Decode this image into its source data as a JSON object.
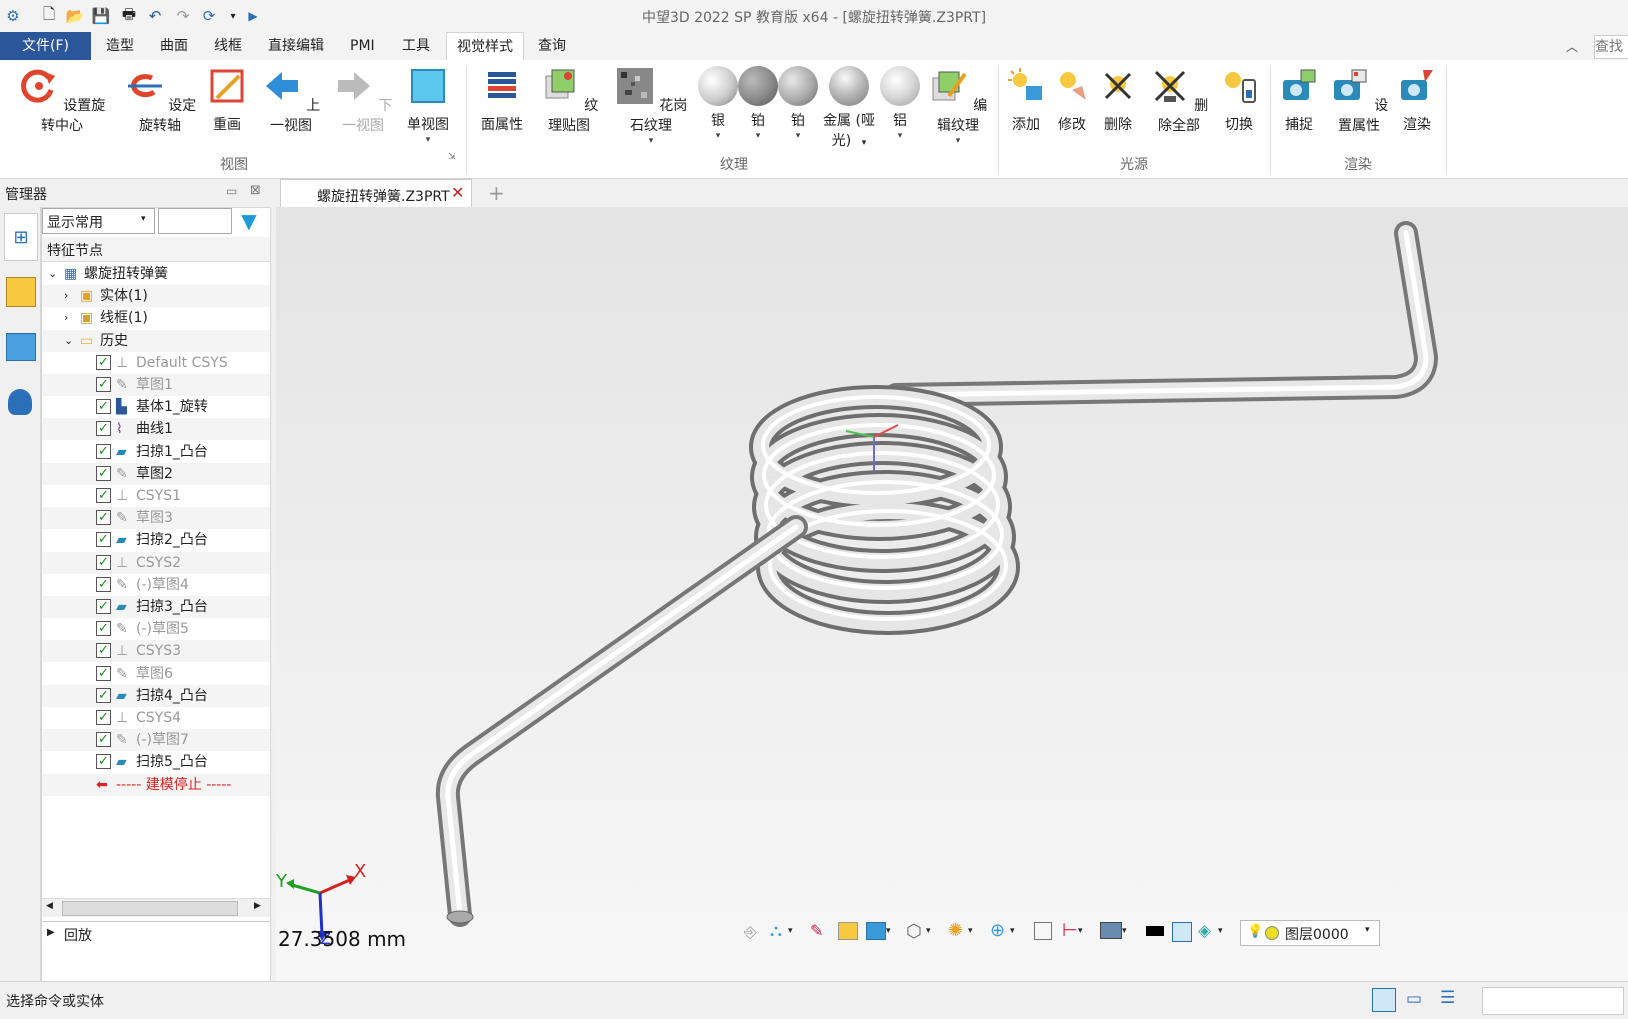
{
  "window": {
    "title": "中望3D 2022 SP 教育版 x64 - [螺旋扭转弹簧.Z3PRT]",
    "search_placeholder": "查找"
  },
  "menu": {
    "file": "文件(F)",
    "tabs": [
      "造型",
      "曲面",
      "线框",
      "直接编辑",
      "PMI",
      "工具",
      "视觉样式",
      "查询"
    ],
    "active_tab": "视觉样式"
  },
  "ribbon": {
    "view_group": {
      "label": "视图",
      "buttons": [
        "设置旋转中心",
        "设定旋转轴",
        "重画",
        "上一视图",
        "下一视图",
        "单视图"
      ]
    },
    "texture_group": {
      "label": "纹理",
      "buttons": [
        "面属性",
        "纹理贴图",
        "花岗石纹理",
        "银",
        "铂",
        "铂",
        "金属 (哑光)",
        "铝",
        "编辑纹理"
      ],
      "metal_line1": "金属 (哑",
      "metal_line2": "光)"
    },
    "light_group": {
      "label": "光源",
      "buttons": [
        "添加",
        "修改",
        "删除",
        "删除全部",
        "切换"
      ]
    },
    "render_group": {
      "label": "渲染",
      "buttons": [
        "捕捉",
        "设置属性",
        "渲染"
      ]
    }
  },
  "manager": {
    "title": "管理器",
    "filter_value": "显示常用",
    "column_header": "特征节点",
    "playback_label": "回放",
    "tree": [
      {
        "label": "螺旋扭转弹簧",
        "level": 0,
        "expander": "open",
        "icon": "part-icon"
      },
      {
        "label": "实体(1)",
        "level": 1,
        "expander": "closed",
        "icon": "solid-folder-icon"
      },
      {
        "label": "线框(1)",
        "level": 1,
        "expander": "closed",
        "icon": "wireframe-folder-icon"
      },
      {
        "label": "历史",
        "level": 1,
        "expander": "open",
        "icon": "history-folder-icon"
      },
      {
        "label": "Default CSYS",
        "level": 2,
        "checked": true,
        "grey": true,
        "icon": "csys-icon"
      },
      {
        "label": "草图1",
        "level": 2,
        "checked": true,
        "grey": true,
        "icon": "sketch-icon"
      },
      {
        "label": "基体1_旋转",
        "level": 2,
        "checked": true,
        "grey": false,
        "icon": "revolve-icon"
      },
      {
        "label": "曲线1",
        "level": 2,
        "checked": true,
        "grey": false,
        "icon": "curve-icon"
      },
      {
        "label": "扫掠1_凸台",
        "level": 2,
        "checked": true,
        "grey": false,
        "icon": "sweep-icon"
      },
      {
        "label": "草图2",
        "level": 2,
        "checked": true,
        "grey": false,
        "icon": "sketch-icon"
      },
      {
        "label": "CSYS1",
        "level": 2,
        "checked": true,
        "grey": true,
        "icon": "csys-icon"
      },
      {
        "label": "草图3",
        "level": 2,
        "checked": true,
        "grey": true,
        "icon": "sketch-icon"
      },
      {
        "label": "扫掠2_凸台",
        "level": 2,
        "checked": true,
        "grey": false,
        "icon": "sweep-icon"
      },
      {
        "label": "CSYS2",
        "level": 2,
        "checked": true,
        "grey": true,
        "icon": "csys-icon"
      },
      {
        "label": "(-)草图4",
        "level": 2,
        "checked": true,
        "grey": true,
        "icon": "sketch-icon"
      },
      {
        "label": "扫掠3_凸台",
        "level": 2,
        "checked": true,
        "grey": false,
        "icon": "sweep-icon"
      },
      {
        "label": "(-)草图5",
        "level": 2,
        "checked": true,
        "grey": true,
        "icon": "sketch-icon"
      },
      {
        "label": "CSYS3",
        "level": 2,
        "checked": true,
        "grey": true,
        "icon": "csys-icon"
      },
      {
        "label": "草图6",
        "level": 2,
        "checked": true,
        "grey": true,
        "icon": "sketch-icon"
      },
      {
        "label": "扫掠4_凸台",
        "level": 2,
        "checked": true,
        "grey": false,
        "icon": "sweep-icon"
      },
      {
        "label": "CSYS4",
        "level": 2,
        "checked": true,
        "grey": true,
        "icon": "csys-icon"
      },
      {
        "label": "(-)草图7",
        "level": 2,
        "checked": true,
        "grey": true,
        "icon": "sketch-icon"
      },
      {
        "label": "扫掠5_凸台",
        "level": 2,
        "checked": true,
        "grey": false,
        "icon": "sweep-icon"
      },
      {
        "label": "----- 建模停止 -----",
        "level": 2,
        "stop": true,
        "icon": "stop-arrow-icon"
      }
    ]
  },
  "document": {
    "tab_label": "螺旋扭转弹簧.Z3PRT",
    "measurement": "27.3508 mm",
    "axis_x": "X",
    "axis_y": "Y",
    "axis_z": "Z",
    "layer_label": "图层0000"
  },
  "status": {
    "prompt": "选择命令或实体"
  },
  "colors": {
    "file_tab": "#2b579a",
    "stop_marker": "#e02020",
    "check": "#1d8a1d"
  }
}
